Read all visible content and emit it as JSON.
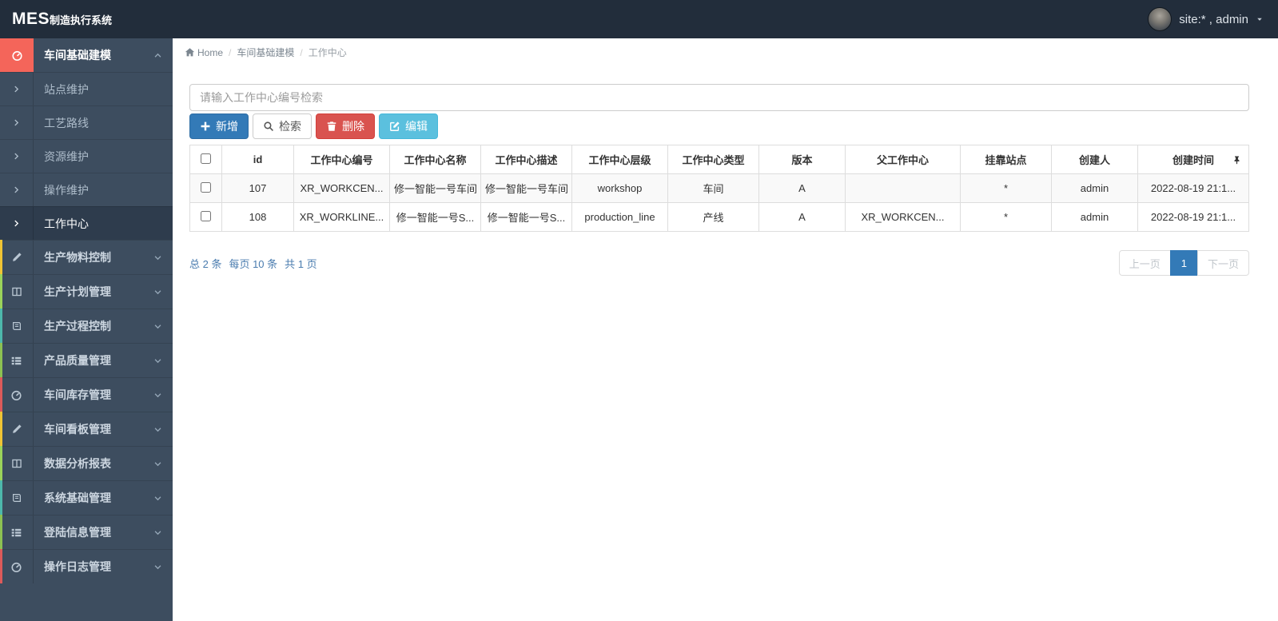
{
  "app": {
    "title_bold": "MES",
    "title_rest": "制造执行系统",
    "user_label": "site:* , admin"
  },
  "breadcrumb": {
    "home": "Home",
    "path": [
      "车间基础建模",
      "工作中心"
    ]
  },
  "sidebar": {
    "group": {
      "label": "车间基础建模",
      "icon": "dashboard-icon",
      "accent": "#f4655a"
    },
    "subitems": [
      {
        "label": "站点维护",
        "active": false
      },
      {
        "label": "工艺路线",
        "active": false
      },
      {
        "label": "资源维护",
        "active": false
      },
      {
        "label": "操作维护",
        "active": false
      },
      {
        "label": "工作中心",
        "active": true
      }
    ],
    "items": [
      {
        "label": "生产物料控制",
        "icon": "edit-icon",
        "strip": "#f0c434"
      },
      {
        "label": "生产计划管理",
        "icon": "columns-icon",
        "strip": "#9bd35a"
      },
      {
        "label": "生产过程控制",
        "icon": "book-icon",
        "strip": "#4db8ac"
      },
      {
        "label": "产品质量管理",
        "icon": "list-icon",
        "strip": "#8cc152"
      },
      {
        "label": "车间库存管理",
        "icon": "dashboard-icon",
        "strip": "#dd5a5a"
      },
      {
        "label": "车间看板管理",
        "icon": "edit-icon",
        "strip": "#f0c434"
      },
      {
        "label": "数据分析报表",
        "icon": "columns-icon",
        "strip": "#9bd35a"
      },
      {
        "label": "系统基础管理",
        "icon": "book-icon",
        "strip": "#4db8ac"
      },
      {
        "label": "登陆信息管理",
        "icon": "list-icon",
        "strip": "#8cc152"
      },
      {
        "label": "操作日志管理",
        "icon": "dashboard-icon",
        "strip": "#dd5a5a"
      }
    ]
  },
  "toolbar": {
    "search_placeholder": "请输入工作中心编号检索",
    "buttons": [
      {
        "name": "add-button",
        "label": "新增",
        "icon": "plus-icon",
        "style": "primary"
      },
      {
        "name": "search-button",
        "label": "检索",
        "icon": "search-icon",
        "style": "default"
      },
      {
        "name": "delete-button",
        "label": "删除",
        "icon": "trash-icon",
        "style": "danger"
      },
      {
        "name": "edit-button",
        "label": "编辑",
        "icon": "edit-square-icon",
        "style": "info"
      }
    ]
  },
  "table": {
    "columns": [
      "id",
      "工作中心编号",
      "工作中心名称",
      "工作中心描述",
      "工作中心层级",
      "工作中心类型",
      "版本",
      "父工作中心",
      "挂靠站点",
      "创建人",
      "创建时间"
    ],
    "rows": [
      {
        "cells": [
          "107",
          "XR_WORKCEN...",
          "修一智能一号车间",
          "修一智能一号车间",
          "workshop",
          "车间",
          "A",
          "",
          "*",
          "admin",
          "2022-08-19 21:1..."
        ]
      },
      {
        "cells": [
          "108",
          "XR_WORKLINE...",
          "修一智能一号S...",
          "修一智能一号S...",
          "production_line",
          "产线",
          "A",
          "XR_WORKCEN...",
          "*",
          "admin",
          "2022-08-19 21:1..."
        ]
      }
    ]
  },
  "footer": {
    "summary_total": "总 2 条",
    "summary_per": "每页 10 条",
    "summary_pages": "共 1 页",
    "prev_label": "上一页",
    "current_page": "1",
    "next_label": "下一页"
  },
  "colors": {
    "topbar_bg": "#222d3b",
    "sidebar_bg": "#3d4d5f",
    "sidebar_active_bg": "#2e3c4d",
    "group_icon_bg": "#f4655a",
    "primary": "#337ab7",
    "danger": "#d9534f",
    "info": "#5bc0de",
    "pagination_active": "#337ab7"
  }
}
